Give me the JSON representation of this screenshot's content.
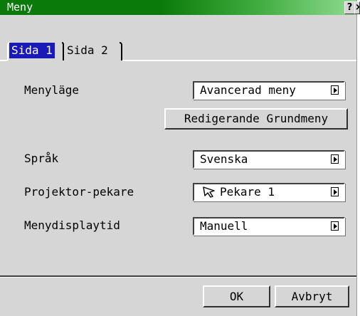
{
  "window": {
    "title": "Meny",
    "help_label": "?",
    "close_label": "×"
  },
  "tabs": [
    {
      "label": "Sida 1",
      "active": true
    },
    {
      "label": "Sida 2",
      "active": false
    }
  ],
  "settings": {
    "menu_mode": {
      "label": "Menyläge",
      "value": "Avancerad meny"
    },
    "edit_button": {
      "label": "Redigerande Grundmeny"
    },
    "language": {
      "label": "Språk",
      "value": "Svenska"
    },
    "pointer": {
      "label": "Projektor-pekare",
      "value": "Pekare 1",
      "icon": "pointer-arrow-icon"
    },
    "display_time": {
      "label": "Menydisplaytid",
      "value": "Manuell"
    }
  },
  "footer": {
    "ok_label": "OK",
    "cancel_label": "Avbryt"
  },
  "colors": {
    "title_bar": "#0a7a0a",
    "active_tab": "#1a1ab8",
    "window_bg": "#d6d6d6"
  }
}
